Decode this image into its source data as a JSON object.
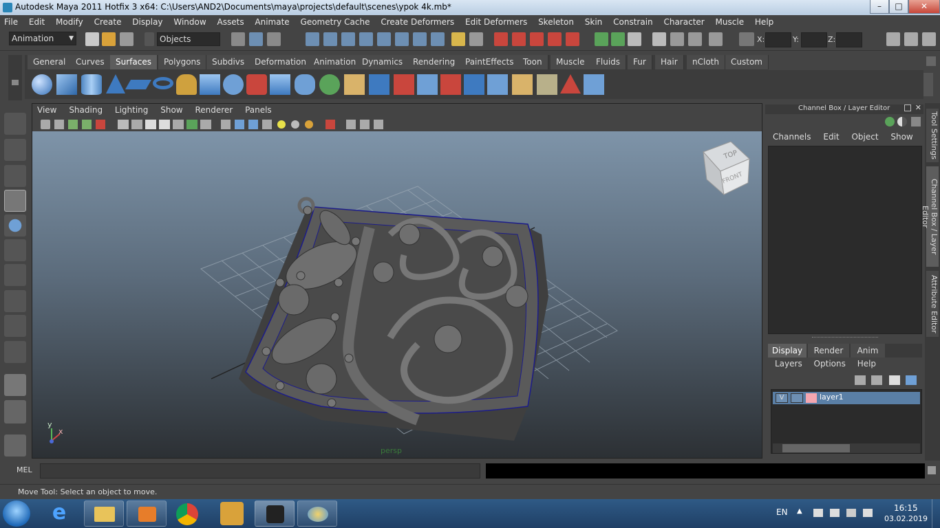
{
  "window": {
    "title": "Autodesk Maya 2011 Hotfix 3 x64: C:\\Users\\AND2\\Documents\\maya\\projects\\default\\scenes\\ypok 4k.mb*",
    "min": "–",
    "max": "□",
    "close": "✕"
  },
  "menu": [
    "File",
    "Edit",
    "Modify",
    "Create",
    "Display",
    "Window",
    "Assets",
    "Animate",
    "Geometry Cache",
    "Create Deformers",
    "Edit Deformers",
    "Skeleton",
    "Skin",
    "Constrain",
    "Character",
    "Muscle",
    "Help"
  ],
  "status": {
    "menuset": "Animation",
    "selection_mask": "Objects",
    "x_label": "X:",
    "y_label": "Y:",
    "z_label": "Z:"
  },
  "shelf_tabs": [
    "General",
    "Curves",
    "Surfaces",
    "Polygons",
    "Subdivs",
    "Deformation",
    "Animation",
    "Dynamics",
    "Rendering",
    "PaintEffects",
    "Toon",
    "Muscle",
    "Fluids",
    "Fur",
    "Hair",
    "nCloth",
    "Custom"
  ],
  "shelf_active": "Surfaces",
  "viewport": {
    "menu": [
      "View",
      "Shading",
      "Lighting",
      "Show",
      "Renderer",
      "Panels"
    ],
    "viewcube_top": "TOP",
    "viewcube_front": "FRONT",
    "axis_x": "x",
    "axis_y": "y",
    "camera_label": "persp"
  },
  "channel_box": {
    "title": "Channel Box / Layer Editor",
    "menu": [
      "Channels",
      "Edit",
      "Object",
      "Show"
    ],
    "layer_tabs": [
      "Display",
      "Render",
      "Anim"
    ],
    "layer_menu": [
      "Layers",
      "Options",
      "Help"
    ],
    "layer": {
      "visibility": "V",
      "name": "layer1",
      "color": "#f4a6b0"
    }
  },
  "side_tabs": [
    "Tool Settings",
    "Channel Box / Layer Editor",
    "Attribute Editor"
  ],
  "mel": {
    "label": "MEL"
  },
  "help_line": "Move Tool: Select an object to move.",
  "taskbar": {
    "lang": "EN",
    "time": "16:15",
    "date": "03.02.2019"
  },
  "colors": {
    "accent": "#5d7fa3",
    "viewport_top": "#7e94a9",
    "viewport_bottom": "#2c3034",
    "layer_selected": "#5a7fa6"
  }
}
